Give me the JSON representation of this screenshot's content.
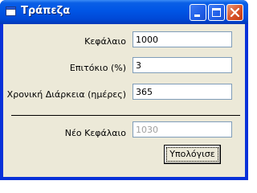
{
  "window": {
    "title": "Τράπεζα"
  },
  "form": {
    "capital": {
      "label": "Κεφάλαιο",
      "value": "1000"
    },
    "interest": {
      "label": "Επιτόκιο (%)",
      "value": "3"
    },
    "duration": {
      "label": "Χρονική Διάρκεια (ημέρες)",
      "value": "365"
    },
    "new_capital": {
      "label": "Νέο Κεφάλαιο",
      "value": "1030"
    },
    "calculate_label": "Υπολόγισε"
  },
  "icons": [
    "app-icon",
    "minimize-icon",
    "maximize-icon",
    "close-icon"
  ],
  "colors": {
    "titlebar": "#0055e5",
    "client": "#ece9d8",
    "close": "#d9562e"
  }
}
